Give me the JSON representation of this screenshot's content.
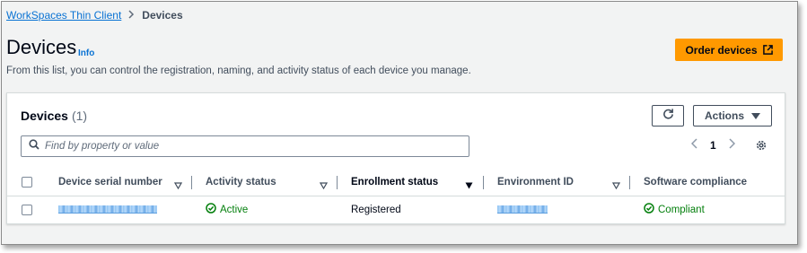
{
  "breadcrumb": {
    "parent": "WorkSpaces Thin Client",
    "current": "Devices"
  },
  "header": {
    "title": "Devices",
    "info": "Info",
    "description": "From this list, you can control the registration, naming, and activity status of each device you manage.",
    "order_button": "Order devices"
  },
  "panel": {
    "title": "Devices",
    "count": "(1)",
    "actions_label": "Actions",
    "search_placeholder": "Find by property or value",
    "page": "1"
  },
  "table": {
    "columns": [
      {
        "label": "Device serial number",
        "sortable": true
      },
      {
        "label": "Activity status",
        "sortable": true
      },
      {
        "label": "Enrollment status",
        "sortable": true,
        "sorted": true
      },
      {
        "label": "Environment ID",
        "sortable": true
      },
      {
        "label": "Software compliance",
        "sortable": false
      }
    ],
    "rows": [
      {
        "serial": "[redacted]",
        "activity": "Active",
        "enrollment": "Registered",
        "environment": "[redacted]",
        "compliance": "Compliant"
      }
    ]
  },
  "colors": {
    "accent": "#ff9900",
    "link": "#0972d3",
    "success": "#037f0c"
  },
  "icons": [
    "chevron-right-icon",
    "external-link-icon",
    "refresh-icon",
    "caret-down-icon",
    "search-icon",
    "chevron-left-icon",
    "settings-icon",
    "sort-icon",
    "check-circle-icon"
  ]
}
